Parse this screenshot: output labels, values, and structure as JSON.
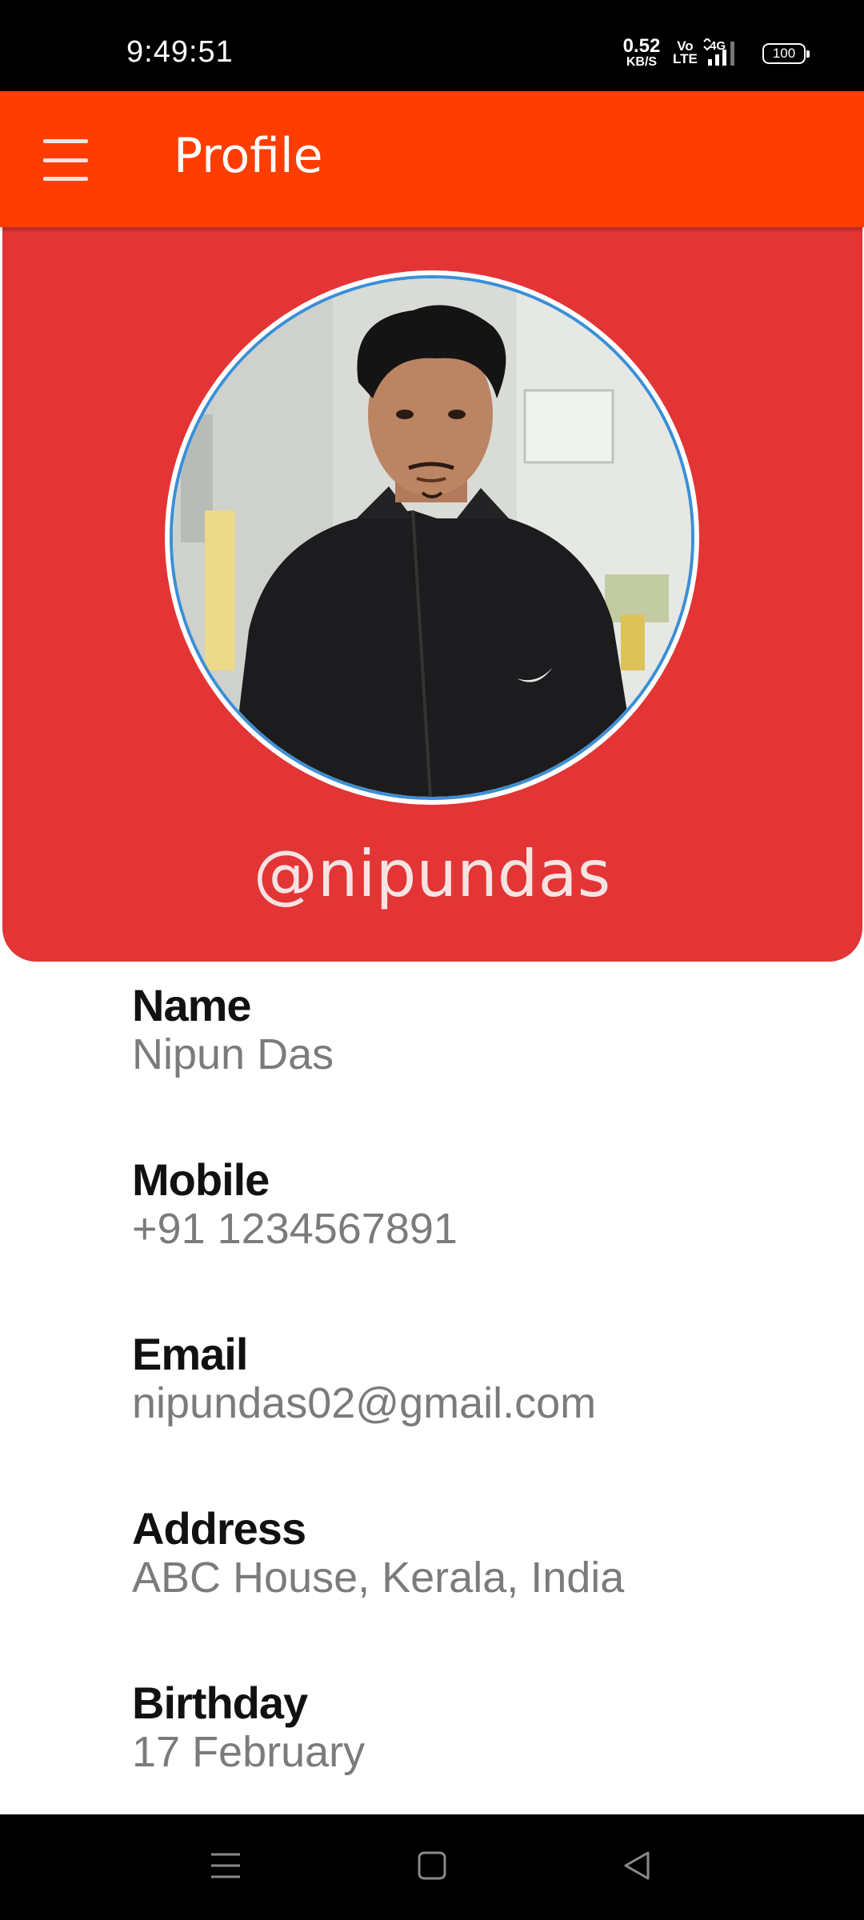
{
  "status_bar": {
    "time": "9:49:51",
    "speed_value": "0.52",
    "speed_unit": "KB/S",
    "volte_top": "Vo",
    "volte_bottom": "LTE",
    "network": "4G",
    "battery": "100"
  },
  "app_bar": {
    "title": "Profile",
    "menu_icon": "hamburger-menu-icon",
    "color": "#ff3d00"
  },
  "header": {
    "color": "#e33535",
    "username": "@nipundas",
    "avatar_border_color": "#3b8fd6"
  },
  "fields": [
    {
      "label": "Name",
      "value": "Nipun Das"
    },
    {
      "label": "Mobile",
      "value": "+91 1234567891"
    },
    {
      "label": "Email",
      "value": "nipundas02@gmail.com"
    },
    {
      "label": "Address",
      "value": "ABC House, Kerala, India"
    },
    {
      "label": "Birthday",
      "value": "17 February"
    }
  ],
  "nav_bar": {
    "recent_icon": "recent-apps-icon",
    "home_icon": "home-icon",
    "back_icon": "back-icon"
  }
}
